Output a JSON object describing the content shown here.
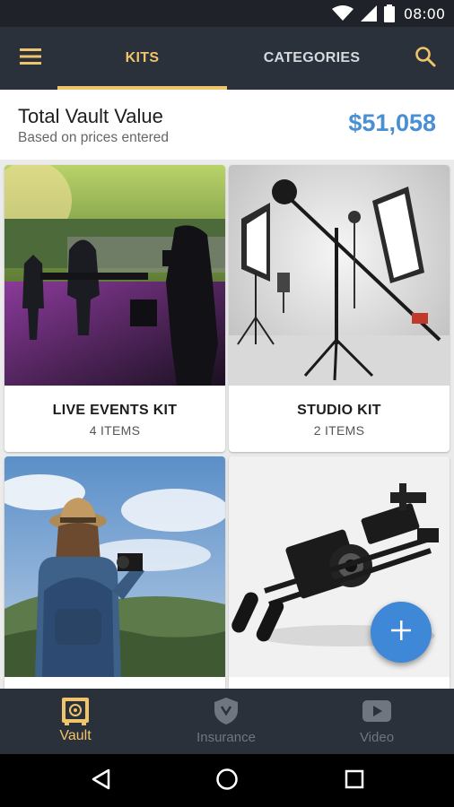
{
  "status_bar": {
    "time": "08:00",
    "icons": [
      "wifi-icon",
      "signal-icon",
      "battery-icon"
    ]
  },
  "app_bar": {
    "menu_icon": "hamburger-menu-icon",
    "search_icon": "search-icon",
    "tabs": [
      {
        "label": "KITS",
        "selected": true
      },
      {
        "label": "CATEGORIES",
        "selected": false
      }
    ]
  },
  "vault": {
    "title": "Total Vault Value",
    "subtitle": "Based on prices entered",
    "amount": "$51,058"
  },
  "kits": [
    {
      "title": "LIVE EVENTS KIT",
      "count": "4 ITEMS",
      "image": "concert-stage-photo"
    },
    {
      "title": "STUDIO KIT",
      "count": "2 ITEMS",
      "image": "studio-lights-photo"
    },
    {
      "title": "",
      "count": "",
      "image": "traveler-backpack-photo"
    },
    {
      "title": "",
      "count": "",
      "image": "camera-rig-photo"
    }
  ],
  "fab": {
    "icon": "plus-icon"
  },
  "bottom_nav": [
    {
      "label": "Vault",
      "icon": "vault-safe-icon",
      "active": true
    },
    {
      "label": "Insurance",
      "icon": "shield-icon",
      "active": false
    },
    {
      "label": "Video",
      "icon": "play-video-icon",
      "active": false
    }
  ],
  "system_nav": [
    "back-icon",
    "home-icon",
    "recent-apps-icon"
  ],
  "colors": {
    "accent": "#efc46a",
    "toolbar": "#2b313a",
    "amount_blue": "#4a8fd3",
    "fab_blue": "#3f88d8"
  }
}
